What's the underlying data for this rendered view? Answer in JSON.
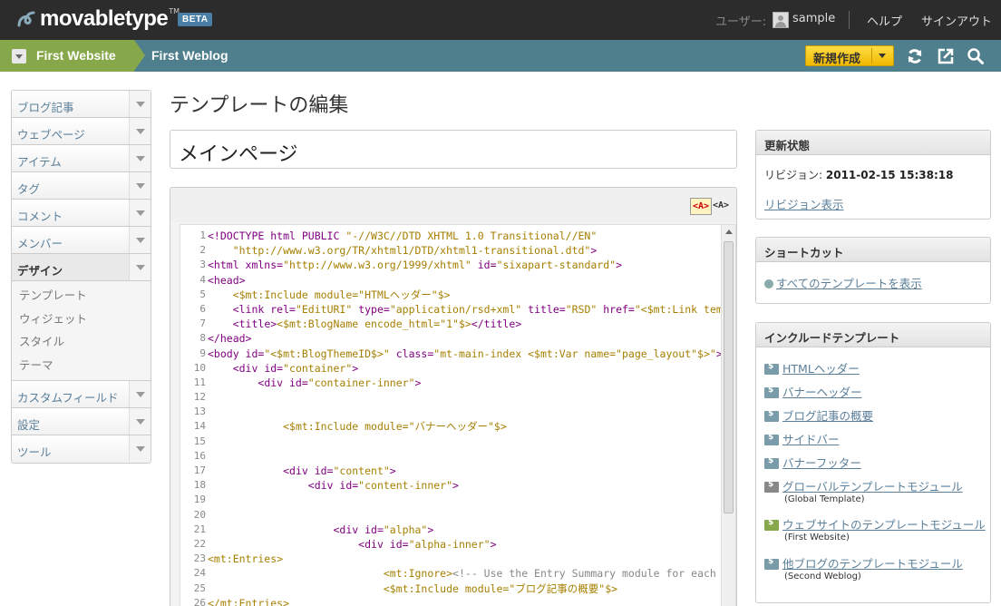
{
  "topbar": {
    "logo_text": "movabletype",
    "logo_tm": "TM",
    "beta_label": "BETA",
    "user_label": "ユーザー:",
    "username": "sample",
    "help": "ヘルプ",
    "signout": "サインアウト"
  },
  "context": {
    "website": "First Website",
    "blog": "First Weblog",
    "new_button": "新規作成"
  },
  "nav": {
    "items": [
      {
        "label": "ブログ記事"
      },
      {
        "label": "ウェブページ"
      },
      {
        "label": "アイテム"
      },
      {
        "label": "タグ"
      },
      {
        "label": "コメント"
      },
      {
        "label": "メンバー"
      },
      {
        "label": "デザイン"
      },
      {
        "label": "カスタムフィールド"
      },
      {
        "label": "設定"
      },
      {
        "label": "ツール"
      }
    ],
    "design_sub": [
      {
        "label": "テンプレート"
      },
      {
        "label": "ウィジェット"
      },
      {
        "label": "スタイル"
      },
      {
        "label": "テーマ"
      }
    ]
  },
  "main": {
    "page_title": "テンプレートの編集",
    "template_name": "メインページ",
    "highlight_on": "<A>",
    "highlight_off": "<A>",
    "line_numbers": [
      "1",
      "2",
      "3",
      "4",
      "5",
      "6",
      "7",
      "8",
      "9",
      "10",
      "11",
      "12",
      "13",
      "14",
      "15",
      "16",
      "17",
      "18",
      "19",
      "20",
      "21",
      "22",
      "23",
      "24",
      "25",
      "26"
    ]
  },
  "widgets": {
    "revision": {
      "title": "更新状態",
      "label": "リビジョン:",
      "value": "2011-02-15 15:38:18",
      "link": "リビジョン表示"
    },
    "shortcut": {
      "title": "ショートカット",
      "link": "すべてのテンプレートを表示"
    },
    "includes": {
      "title": "インクルードテンプレート",
      "items": [
        {
          "label": "HTMLヘッダー",
          "sub": ""
        },
        {
          "label": "バナーヘッダー",
          "sub": ""
        },
        {
          "label": "ブログ記事の概要",
          "sub": ""
        },
        {
          "label": "サイドバー",
          "sub": ""
        },
        {
          "label": "バナーフッター",
          "sub": ""
        },
        {
          "label": "グローバルテンプレートモジュール",
          "sub": "(Global Template)"
        },
        {
          "label": "ウェブサイトのテンプレートモジュール",
          "sub": "(First Website)"
        },
        {
          "label": "他ブログのテンプレートモジュール",
          "sub": "(Second Weblog)"
        }
      ]
    }
  },
  "icons": {
    "logo": "movabletype-swirl-icon",
    "refresh": "refresh-icon",
    "view_site": "external-link-icon",
    "search": "search-icon",
    "module": "template-module-icon"
  },
  "colors": {
    "accent_green": "#86a84a",
    "context_blue": "#4f7f8c",
    "new_button": "#f5c21a",
    "link": "#5a7f9a"
  }
}
